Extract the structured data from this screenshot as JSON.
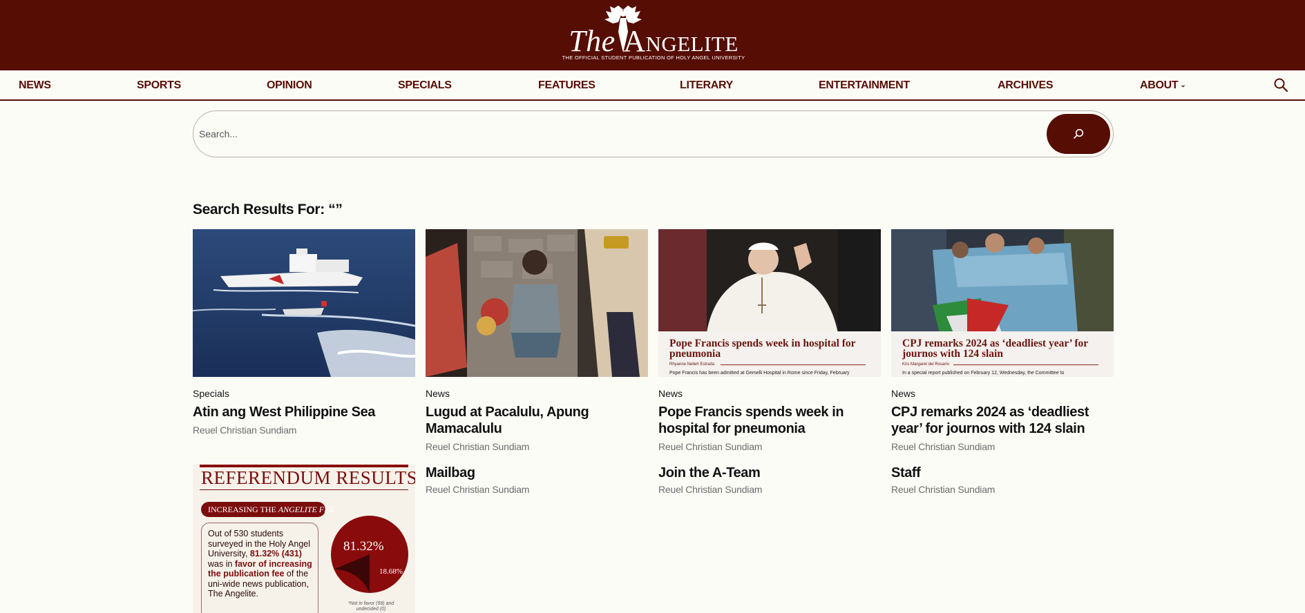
{
  "site": {
    "logo_word_the": "The",
    "logo_word_name": "Angelite",
    "tagline": "THE OFFICIAL STUDENT PUBLICATION OF HOLY ANGEL UNIVERSITY"
  },
  "nav": {
    "items": [
      "NEWS",
      "SPORTS",
      "OPINION",
      "SPECIALS",
      "FEATURES",
      "LITERARY",
      "ENTERTAINMENT",
      "ARCHIVES",
      "ABOUT"
    ],
    "about_chevron": "⌄",
    "search_icon": "search-icon"
  },
  "search": {
    "placeholder": "Search...",
    "value": "",
    "button_icon": "search-icon"
  },
  "results": {
    "heading": "Search Results For: “”",
    "cards": [
      {
        "category": "Specials",
        "title": "Atin ang West Philippine Sea",
        "author": "Reuel Christian Sundiam"
      },
      {
        "category": "News",
        "title": "Lugud at Pacalulu, Apung Mamacalulu",
        "author": "Reuel Christian Sundiam"
      },
      {
        "category": "News",
        "title": "Pope Francis spends week in hospital for pneumonia",
        "author": "Reuel Christian Sundiam",
        "thumb_title": "Pope Francis spends week in hospital for pneumonia",
        "thumb_byline": "Rhyanne Nelleh Estrada",
        "thumb_body": "Pope Francis has been admitted at Gemelli Hospital in Rome since Friday, February"
      },
      {
        "category": "News",
        "title": "CPJ remarks 2024 as ‘deadliest year’ for journos with 124 slain",
        "author": "Reuel Christian Sundiam",
        "thumb_title": "CPJ remarks 2024 as ‘deadliest year’ for journos with 124 slain",
        "thumb_byline": "Kris Margaret del Rosario",
        "thumb_body": "In a special report published on February 12, Wednesday, the Committee to"
      }
    ],
    "pages": [
      {
        "title": "Mailbag",
        "author": "Reuel Christian Sundiam"
      },
      {
        "title": "Join the A-Team",
        "author": "Reuel Christian Sundiam"
      },
      {
        "title": "Staff",
        "author": "Reuel Christian Sundiam"
      }
    ],
    "referendum": {
      "title": "REFERENDUM RESULTS",
      "pill_prefix": "INCREASING THE",
      "pill_emph": "ANGELITE FEE",
      "text_1": "Out of 530 students surveyed in the Holy Angel University,",
      "text_2": "81.32% (431)",
      "text_3": "was in",
      "text_4": "favor of increasing the publication fee",
      "text_5": "of the uni-wide news publication, The Angelite.",
      "favor_pct": 81.32,
      "against_pct": 18.68,
      "favor_label": "81.32%",
      "against_label": "18.68%",
      "note": "*Not in favor (99) and undecided (0)"
    }
  },
  "colors": {
    "brand": "#560d04",
    "background": "#fcfcf7",
    "muted_text": "#6b6b6b"
  }
}
